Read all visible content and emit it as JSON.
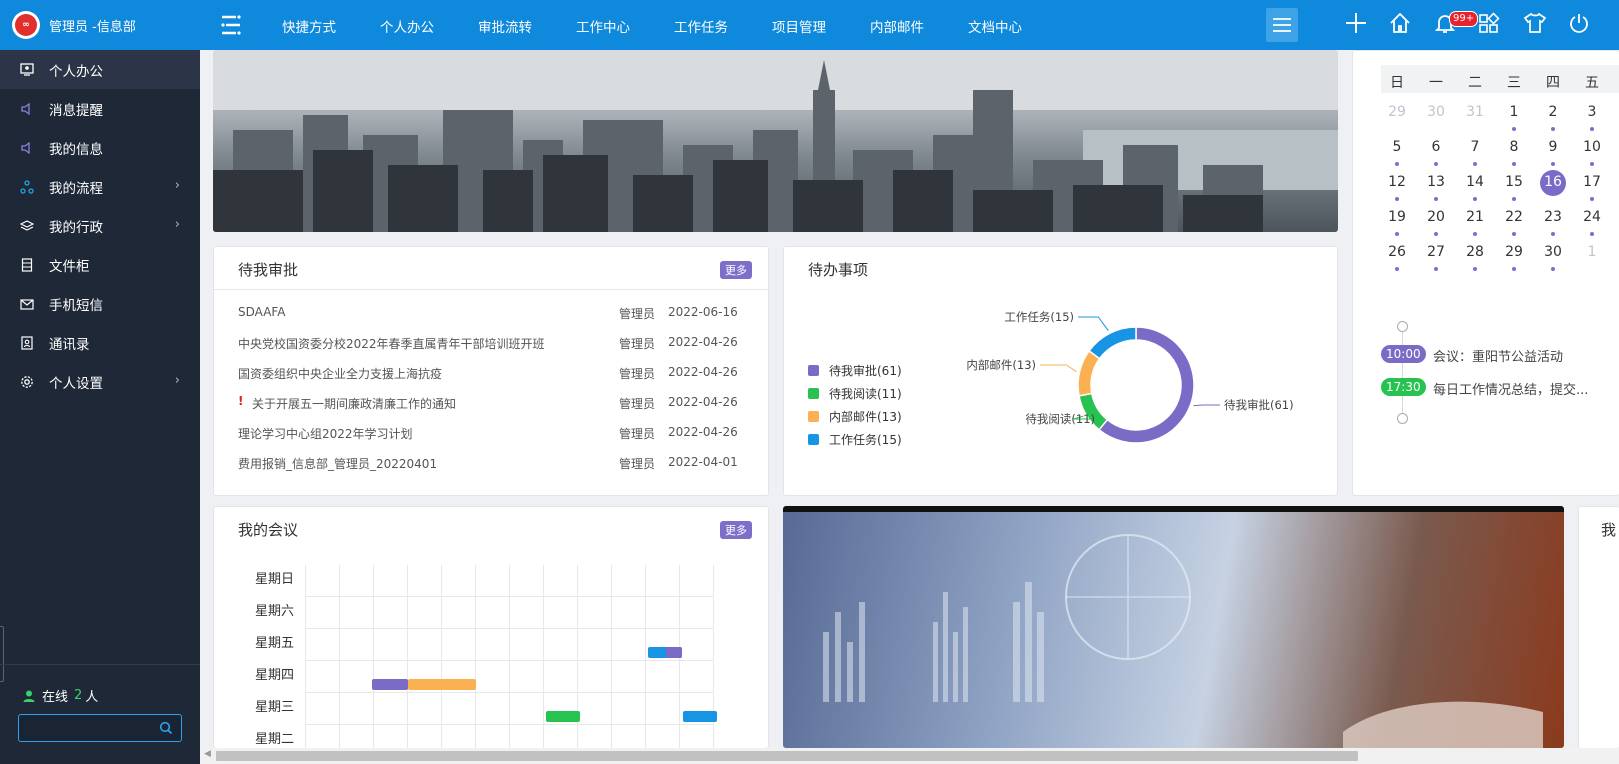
{
  "sidebar": {
    "logo_text": "宇天鑫力",
    "user_label": "管理员 -信息部",
    "items": [
      {
        "label": "个人办公",
        "icon": "desktop-user-icon"
      },
      {
        "label": "消息提醒",
        "icon": "speaker-icon"
      },
      {
        "label": "我的信息",
        "icon": "speaker-icon"
      },
      {
        "label": "我的流程",
        "icon": "flow-icon"
      },
      {
        "label": "我的行政",
        "icon": "layers-icon"
      },
      {
        "label": "文件柜",
        "icon": "cabinet-icon"
      },
      {
        "label": "手机短信",
        "icon": "mail-icon"
      },
      {
        "label": "通讯录",
        "icon": "contacts-icon"
      },
      {
        "label": "个人设置",
        "icon": "gear-icon"
      }
    ],
    "online_prefix": "在线",
    "online_count": "2",
    "online_suffix": "人",
    "search_placeholder": ""
  },
  "topbar": {
    "nav": [
      "快捷方式",
      "个人办公",
      "审批流转",
      "工作中心",
      "工作任务",
      "项目管理",
      "内部邮件",
      "文档中心"
    ],
    "badge": "99+"
  },
  "approvals": {
    "title": "待我审批",
    "more_label": "更多",
    "rows": [
      {
        "title": "SDAAFA",
        "who": "管理员",
        "date": "2022-06-16",
        "urgent": false
      },
      {
        "title": "中央党校国资委分校2022年春季直属青年干部培训班开班",
        "who": "管理员",
        "date": "2022-04-26",
        "urgent": false
      },
      {
        "title": "国资委组织中央企业全力支援上海抗疫",
        "who": "管理员",
        "date": "2022-04-26",
        "urgent": false
      },
      {
        "title": "关于开展五一期间廉政清廉工作的通知",
        "who": "管理员",
        "date": "2022-04-26",
        "urgent": true
      },
      {
        "title": "理论学习中心组2022年学习计划",
        "who": "管理员",
        "date": "2022-04-26",
        "urgent": false
      },
      {
        "title": "费用报销_信息部_管理员_20220401",
        "who": "管理员",
        "date": "2022-04-01",
        "urgent": false
      }
    ]
  },
  "todo": {
    "title": "待办事项",
    "legend": [
      "待我审批(61)",
      "待我阅读(11)",
      "内部邮件(13)",
      "工作任务(15)"
    ],
    "chart_data": {
      "type": "pie",
      "categories": [
        "待我审批",
        "待我阅读",
        "内部邮件",
        "工作任务"
      ],
      "values": [
        61,
        11,
        13,
        15
      ],
      "colors": [
        "#7b6bc6",
        "#28c251",
        "#fbb151",
        "#1794e4"
      ],
      "labels": [
        "待我审批(61)",
        "待我阅读(11)",
        "内部邮件(13)",
        "工作任务(15)"
      ]
    }
  },
  "calendar": {
    "weekdays": [
      "日",
      "一",
      "二",
      "三",
      "四",
      "五"
    ],
    "weeks": [
      [
        "29",
        "30",
        "31",
        "1",
        "2",
        "3"
      ],
      [
        "5",
        "6",
        "7",
        "8",
        "9",
        "10"
      ],
      [
        "12",
        "13",
        "14",
        "15",
        "16",
        "17"
      ],
      [
        "19",
        "20",
        "21",
        "22",
        "23",
        "24"
      ],
      [
        "26",
        "27",
        "28",
        "29",
        "30",
        "1"
      ]
    ],
    "today": "16",
    "events": [
      {
        "time": "10:00",
        "text": "会议：重阳节公益活动",
        "color": "#7b6bc6"
      },
      {
        "time": "17:30",
        "text": "每日工作情况总结，提交...",
        "color": "#28c251"
      }
    ]
  },
  "meetings": {
    "title": "我的会议",
    "more_label": "更多",
    "days": [
      "星期日",
      "星期六",
      "星期五",
      "星期四",
      "星期三",
      "星期二"
    ]
  },
  "right_panel_label": "我"
}
